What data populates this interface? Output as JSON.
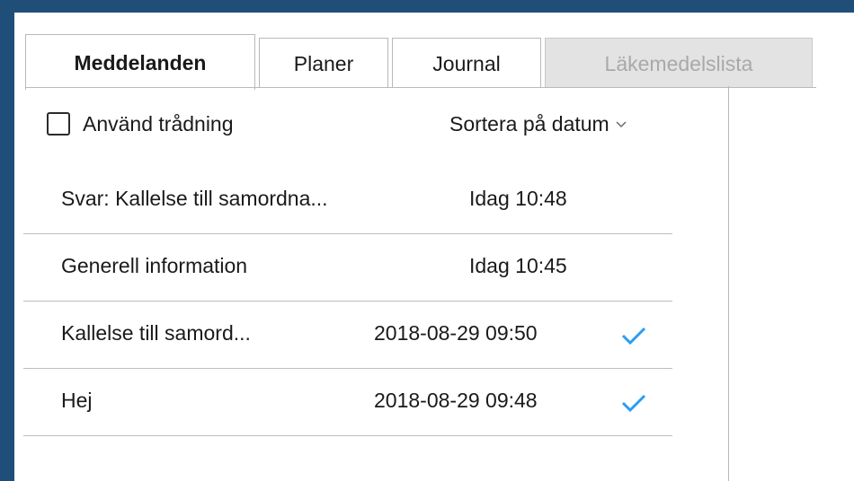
{
  "tabs": [
    {
      "label": "Meddelanden",
      "state": "active"
    },
    {
      "label": "Planer",
      "state": "normal"
    },
    {
      "label": "Journal",
      "state": "normal"
    },
    {
      "label": "Läkemedelslista",
      "state": "disabled"
    }
  ],
  "threading": {
    "label": "Använd trådning",
    "checked": false
  },
  "sort": {
    "label": "Sortera på datum"
  },
  "messages": [
    {
      "subject": "Svar: Kallelse till samordna...",
      "date": "Idag 10:48",
      "read": false
    },
    {
      "subject": "Generell information",
      "date": "Idag 10:45",
      "read": false
    },
    {
      "subject": "Kallelse till samord...",
      "date": "2018-08-29 09:50",
      "read": true
    },
    {
      "subject": "Hej",
      "date": "2018-08-29 09:48",
      "read": true
    }
  ],
  "colors": {
    "frame": "#1f4e79",
    "check": "#2a9df4",
    "divider": "#bdbdbd"
  },
  "icons": {
    "sort": "chevron-down-icon",
    "read": "checkmark-icon"
  }
}
